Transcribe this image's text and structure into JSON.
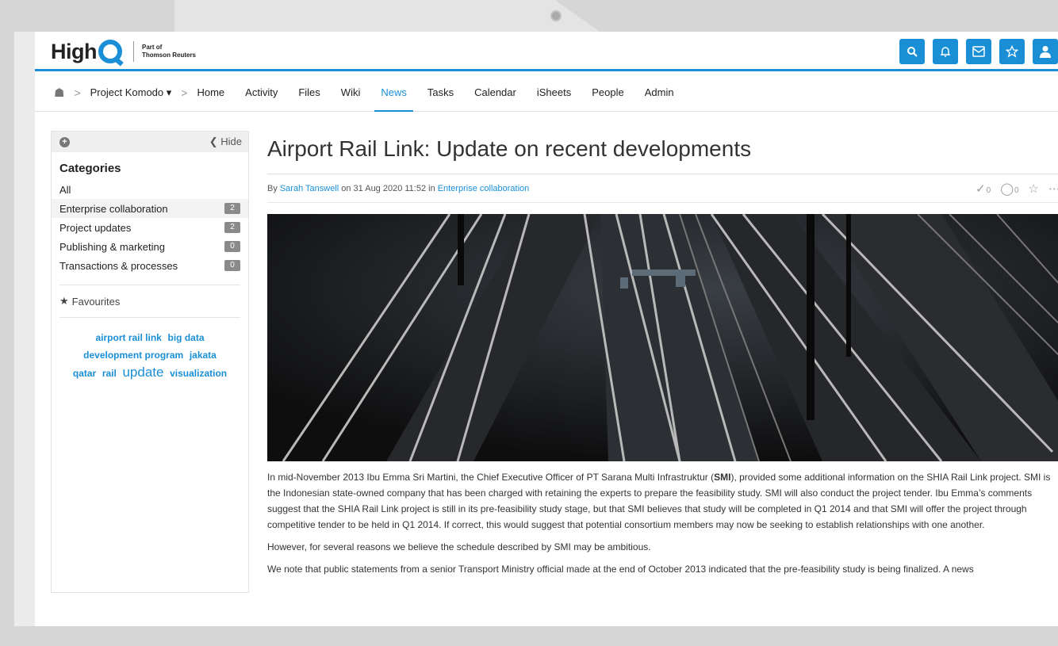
{
  "header": {
    "logo_text": "High",
    "logo_sub1": "Part of",
    "logo_sub2": "Thomson Reuters"
  },
  "nav": {
    "project": "Project Komodo",
    "items": [
      "Home",
      "Activity",
      "Files",
      "Wiki",
      "News",
      "Tasks",
      "Calendar",
      "iSheets",
      "People",
      "Admin"
    ],
    "active": "News"
  },
  "sidebar": {
    "hide_label": "Hide",
    "title": "Categories",
    "categories": [
      {
        "label": "All",
        "count": null
      },
      {
        "label": "Enterprise collaboration",
        "count": "2"
      },
      {
        "label": "Project updates",
        "count": "2"
      },
      {
        "label": "Publishing & marketing",
        "count": "0"
      },
      {
        "label": "Transactions & processes",
        "count": "0"
      }
    ],
    "favourites": "Favourites",
    "tags": [
      "airport rail link",
      "big data",
      "development program",
      "jakata",
      "qatar",
      "rail",
      "update",
      "visualization"
    ]
  },
  "article": {
    "title": "Airport Rail Link: Update on recent developments",
    "by": "By",
    "author": "Sarah Tanswell",
    "on": "on 31 Aug 2020 11:52 in",
    "category": "Enterprise collaboration",
    "approvals": "0",
    "comments": "0",
    "p1_a": "In mid-November 2013 Ibu Emma Sri Martini, the Chief Executive Officer of PT Sarana Multi Infrastruktur (",
    "p1_b": "SMI",
    "p1_c": "), provided some additional information on the SHIA Rail Link project. SMI is the Indonesian state-owned company that has been charged with retaining the experts to prepare the feasibility study. SMI will also conduct the project tender. Ibu Emma’s comments suggest that the SHIA Rail Link project is still in its pre-feasibility study stage, but that SMI believes that study will be completed in Q1 2014 and that SMI will offer the project through competitive tender to be held in Q1 2014. If correct, this would suggest that potential consortium members may now be seeking to establish relationships with one another.",
    "p2": "However, for several reasons we believe the schedule described by SMI may be ambitious.",
    "p3": "We note that public statements from a senior Transport Ministry official made at the end of October 2013 indicated that the pre-feasibility study is being finalized. A news"
  },
  "colors": {
    "accent": "#1a8fd6",
    "badge": "#8a8a8a"
  },
  "icons": [
    "home-icon",
    "search-icon",
    "bell-icon",
    "mail-icon",
    "star-icon",
    "user-icon",
    "plus-circle-icon",
    "chevron-left-icon",
    "approve-icon",
    "comment-icon",
    "more-icon"
  ]
}
